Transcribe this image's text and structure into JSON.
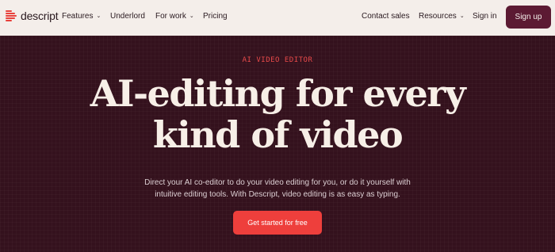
{
  "nav": {
    "logo_text": "descript",
    "features": "Features",
    "underlord": "Underlord",
    "for_work": "For work",
    "pricing": "Pricing",
    "contact_sales": "Contact sales",
    "resources": "Resources",
    "sign_in": "Sign in",
    "sign_up": "Sign up"
  },
  "hero": {
    "eyebrow": "AI VIDEO EDITOR",
    "headline_line1": "AI-editing for every",
    "headline_line2": "kind of video",
    "sub_line1": "Direct your AI co-editor to do your video editing for you, or do it yourself with",
    "sub_line2": "intuitive editing tools. With Descript, video editing is as easy as typing.",
    "cta": "Get started for free"
  },
  "icons": {
    "logo": "descript-logo-icon",
    "dropdown": "chevron-down-icon"
  },
  "colors": {
    "nav_bg": "#f4eeea",
    "hero_bg": "#34111d",
    "accent": "#ee3f3c",
    "signup_bg": "#5c1a33",
    "headline": "#f7efe7"
  }
}
